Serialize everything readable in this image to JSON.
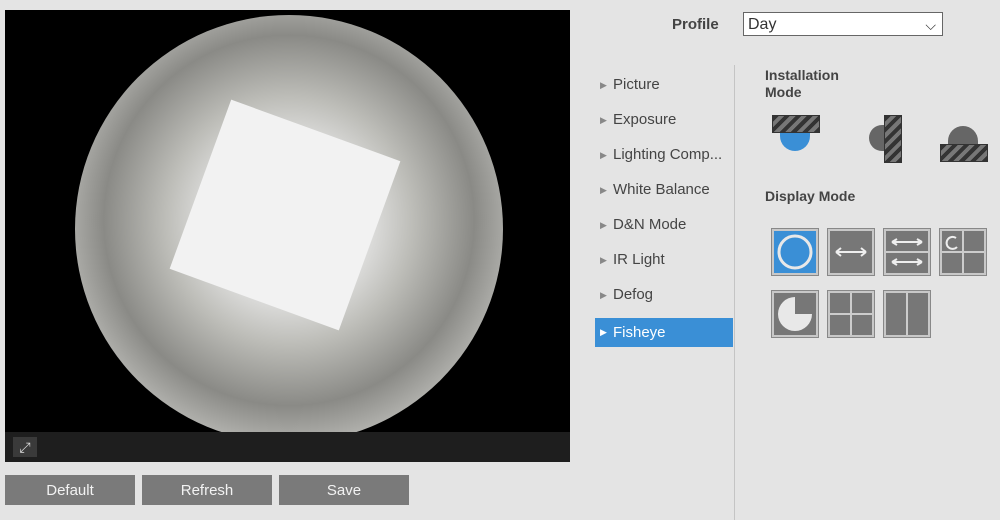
{
  "profile": {
    "label": "Profile",
    "value": "Day"
  },
  "menu": [
    {
      "label": "Picture"
    },
    {
      "label": "Exposure"
    },
    {
      "label": "Lighting Comp..."
    },
    {
      "label": "White Balance"
    },
    {
      "label": "D&N Mode"
    },
    {
      "label": "IR Light"
    },
    {
      "label": "Defog"
    },
    {
      "label": "Fisheye",
      "active": true
    }
  ],
  "installation_mode": {
    "title": "Installation Mode",
    "options": [
      "ceiling",
      "wall",
      "ground"
    ],
    "selected": "ceiling"
  },
  "display_mode": {
    "title": "Display Mode",
    "options": [
      "1O",
      "1P",
      "2P",
      "1O+3R",
      "1R",
      "4R",
      "2R"
    ],
    "selected": "1O"
  },
  "buttons": {
    "default": "Default",
    "refresh": "Refresh",
    "save": "Save"
  },
  "colors": {
    "accent": "#3a8fd6",
    "button": "#7a7a7a"
  }
}
